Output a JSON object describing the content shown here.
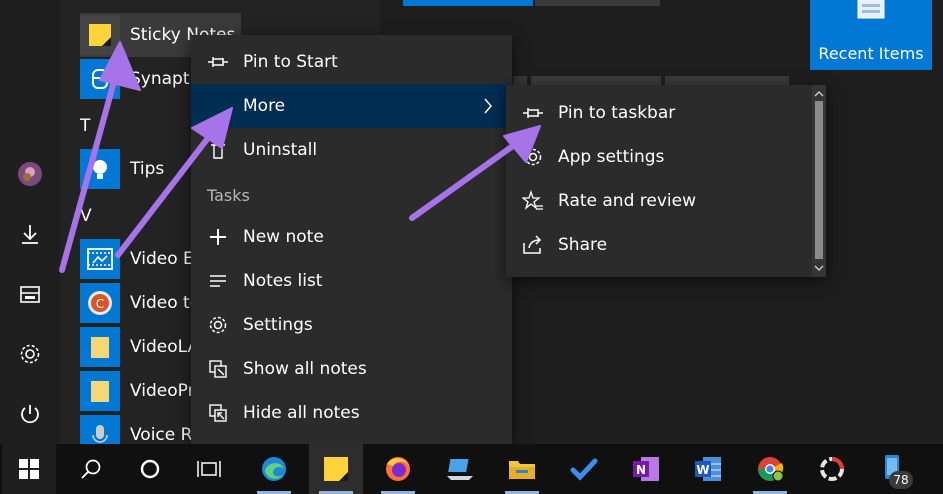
{
  "applist": {
    "apps": [
      {
        "label": "Sticky Notes",
        "icon": "sticky-notes-icon"
      },
      {
        "label": "Synaptics",
        "icon": "synaptics-icon"
      },
      {
        "label": "Tips",
        "icon": "tips-icon"
      },
      {
        "label": "Video Editor",
        "icon": "video-editor-icon"
      },
      {
        "label": "Video to",
        "icon": "video-to-icon"
      },
      {
        "label": "VideoLAN",
        "icon": "folder-icon"
      },
      {
        "label": "VideoProc",
        "icon": "folder-icon"
      },
      {
        "label": "Voice Recorder",
        "icon": "voice-recorder-icon"
      }
    ],
    "letters": [
      "T",
      "V"
    ]
  },
  "tiles": {
    "recent_items_label": "Recent Items"
  },
  "context_menu": {
    "items": [
      {
        "label": "Pin to Start",
        "icon": "pin-icon"
      },
      {
        "label": "More",
        "icon": "chevron-right-icon"
      },
      {
        "label": "Uninstall",
        "icon": "trash-icon"
      }
    ],
    "tasks_header": "Tasks",
    "tasks": [
      {
        "label": "New note",
        "icon": "plus-icon"
      },
      {
        "label": "Notes list",
        "icon": "list-icon"
      },
      {
        "label": "Settings",
        "icon": "gear-icon"
      },
      {
        "label": "Show all notes",
        "icon": "show-windows-icon"
      },
      {
        "label": "Hide all notes",
        "icon": "hide-windows-icon"
      }
    ]
  },
  "submenu": {
    "items": [
      {
        "label": "Pin to taskbar",
        "icon": "pin-icon"
      },
      {
        "label": "App settings",
        "icon": "gear-icon"
      },
      {
        "label": "Rate and review",
        "icon": "star-icon"
      },
      {
        "label": "Share",
        "icon": "share-icon"
      }
    ]
  },
  "taskbar": {
    "badge_count": "78"
  },
  "colors": {
    "accent": "#0078d4",
    "menu_bg": "#2b2b2b",
    "highlight": "#002d52",
    "arrow": "#a673e8"
  }
}
